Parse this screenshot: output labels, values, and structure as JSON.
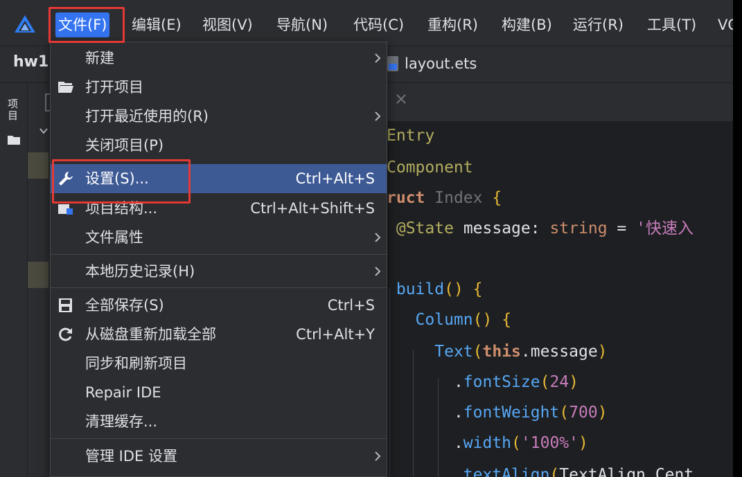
{
  "app": {
    "logo_icon": "harmony-logo-icon"
  },
  "menubar": {
    "items": [
      {
        "label": "文件(F)",
        "active": true
      },
      {
        "label": "编辑(E)"
      },
      {
        "label": "视图(V)"
      },
      {
        "label": "导航(N)"
      },
      {
        "label": "代码(C)"
      },
      {
        "label": "重构(R)"
      },
      {
        "label": "构建(B)"
      },
      {
        "label": "运行(R)"
      },
      {
        "label": "工具(T)"
      },
      {
        "label": "VC"
      }
    ]
  },
  "toolbar": {
    "project_name": "hw1",
    "file_tab": "layout.ets"
  },
  "tool_strip": {
    "label": "项目"
  },
  "file_menu": {
    "items": [
      {
        "label": "新建",
        "shortcut": "",
        "submenu": true
      },
      {
        "label": "打开项目",
        "shortcut": "",
        "icon": "folder-open-icon"
      },
      {
        "label": "打开最近使用的(R)",
        "shortcut": "",
        "submenu": true
      },
      {
        "label": "关闭项目(P)",
        "shortcut": ""
      },
      {
        "label": "设置(S)...",
        "shortcut": "Ctrl+Alt+S",
        "icon": "wrench-icon",
        "selected": true
      },
      {
        "label": "项目结构...",
        "shortcut": "Ctrl+Alt+Shift+S",
        "icon": "project-structure-icon"
      },
      {
        "label": "文件属性",
        "shortcut": "",
        "submenu": true
      },
      {
        "label": "本地历史记录(H)",
        "shortcut": "",
        "submenu": true
      },
      {
        "label": "全部保存(S)",
        "shortcut": "Ctrl+S",
        "icon": "save-icon"
      },
      {
        "label": "从磁盘重新加载全部",
        "shortcut": "Ctrl+Alt+Y",
        "icon": "reload-icon"
      },
      {
        "label": "同步和刷新项目",
        "shortcut": ""
      },
      {
        "label": "Repair IDE",
        "shortcut": ""
      },
      {
        "label": "清理缓存...",
        "shortcut": ""
      },
      {
        "label": "管理 IDE 设置",
        "shortcut": "",
        "submenu": true
      }
    ]
  },
  "editor": {
    "lines": [
      "Entry",
      "Component",
      "ruct Index {",
      " @State message: string = '快速入",
      "",
      " build() {",
      "   Column() {",
      "     Text(this.message)",
      "       .fontSize(24)",
      "       .fontWeight(700)",
      "       .width('100%')",
      "       .textAlign(TextAlign.Cent"
    ]
  },
  "annotations": {
    "color": "#e53935",
    "highlighted": [
      "文件(F)",
      "设置(S)..."
    ]
  },
  "colors": {
    "background": "#2b2d30",
    "editor_background": "#1e1f22",
    "accent": "#3574f0",
    "selection": "#3e5a95",
    "annotation": "#e53935"
  }
}
